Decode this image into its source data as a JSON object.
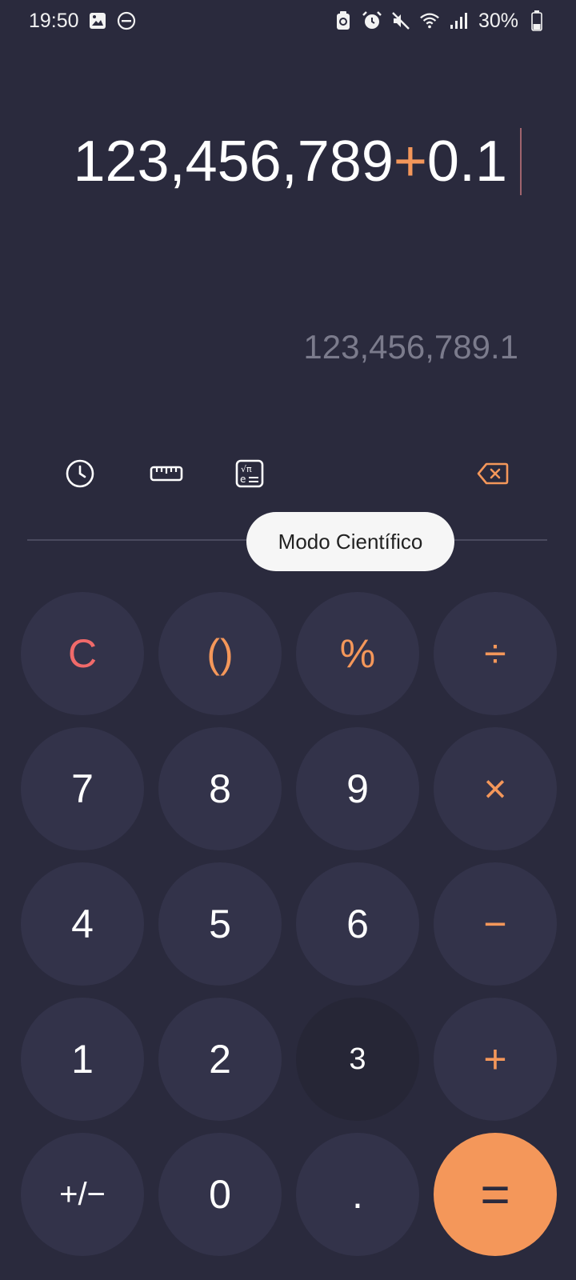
{
  "status_bar": {
    "time": "19:50",
    "battery": "30%",
    "icons_left": [
      "gallery-icon",
      "do-not-disturb-icon"
    ],
    "icons_right": [
      "battery-saver-icon",
      "alarm-icon",
      "mute-icon",
      "wifi-icon",
      "signal-icon",
      "battery-icon"
    ]
  },
  "display": {
    "expression_left": "123,456,789",
    "expression_op": "+",
    "expression_right": "0.1",
    "result": "123,456,789.1"
  },
  "toolbar": {
    "history": "history-icon",
    "converter": "ruler-icon",
    "scientific": "scientific-mode-icon",
    "backspace": "backspace-icon",
    "tooltip": "Modo Científico"
  },
  "keys": {
    "clear": "C",
    "parens": "()",
    "percent": "%",
    "divide": "÷",
    "seven": "7",
    "eight": "8",
    "nine": "9",
    "multiply": "×",
    "four": "4",
    "five": "5",
    "six": "6",
    "minus": "−",
    "one": "1",
    "two": "2",
    "three": "3",
    "plus": "+",
    "sign": "+/−",
    "zero": "0",
    "decimal": ".",
    "equals": "="
  },
  "colors": {
    "background": "#2a2a3d",
    "key": "#33334a",
    "accent": "#f4975a",
    "clear": "#f06a6a"
  }
}
